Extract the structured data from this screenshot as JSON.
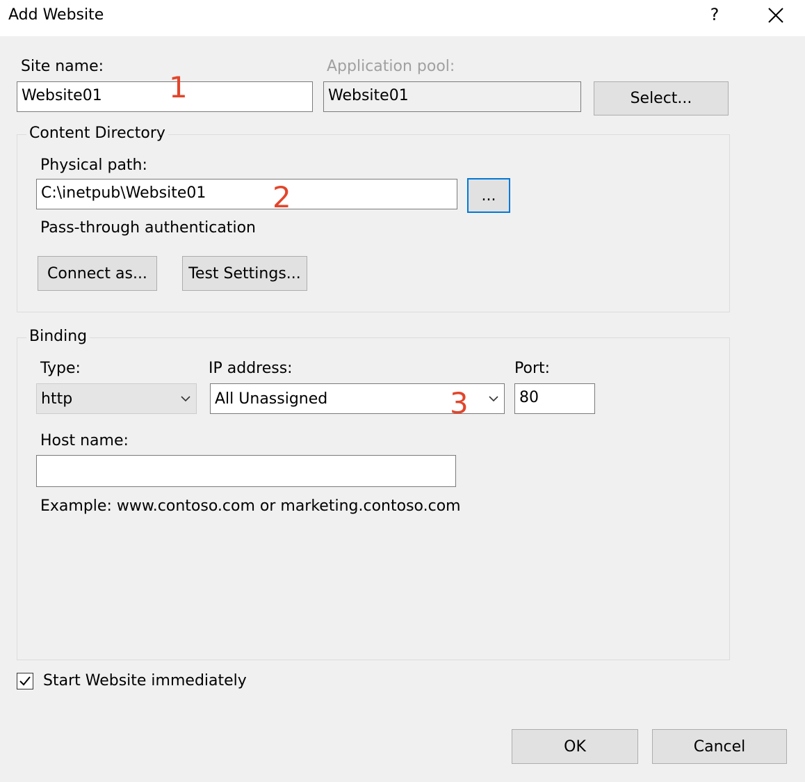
{
  "window": {
    "title": "Add Website",
    "help_label": "?",
    "close_icon": "close-icon"
  },
  "site": {
    "site_name_label": "Site name:",
    "site_name_value": "Website01",
    "app_pool_label": "Application pool:",
    "app_pool_value": "Website01",
    "select_button": "Select..."
  },
  "content_directory": {
    "legend": "Content Directory",
    "physical_path_label": "Physical path:",
    "physical_path_value": "C:\\inetpub\\Website01",
    "browse_button": "...",
    "passthrough_label": "Pass-through authentication",
    "connect_as_button": "Connect as...",
    "test_settings_button": "Test Settings..."
  },
  "binding": {
    "legend": "Binding",
    "type_label": "Type:",
    "type_value": "http",
    "ip_label": "IP address:",
    "ip_value": "All Unassigned",
    "port_label": "Port:",
    "port_value": "80",
    "host_label": "Host name:",
    "host_value": "",
    "example_text": "Example: www.contoso.com or marketing.contoso.com"
  },
  "start_immediately": {
    "label": "Start Website immediately",
    "checked": true
  },
  "footer": {
    "ok_button": "OK",
    "cancel_button": "Cancel"
  },
  "annotations": {
    "marker_1": "1",
    "marker_2": "2",
    "marker_3": "3",
    "color": "#e2452b"
  }
}
